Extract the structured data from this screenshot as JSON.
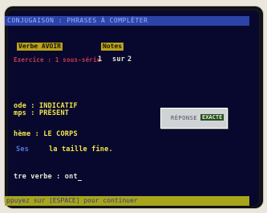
{
  "window": {
    "title": "CONJUGAISON : PHRASES À COMPLÉTER"
  },
  "toolbar": {
    "verb_badge": "Verbe AVOIR",
    "notes_badge": "Notes"
  },
  "progress": {
    "label": "Exercice : 1 sous-série",
    "current": "1",
    "separator": "sur",
    "total": "2"
  },
  "exercise": {
    "mode_label": "ode : INDICATIF",
    "tense_label": "mps : PRÉSENT",
    "theme_label": "hème : LE CORPS",
    "hint_prefix": "Ses",
    "sentence": "la taille fine.",
    "answer_label": "tre verbe : ont"
  },
  "feedback": {
    "label": "RÉPONSE",
    "result": "EXACTE"
  },
  "status": {
    "message": "ppuyez sur [ESPACE] pour continuer"
  },
  "colors": {
    "screen_bg": "#08082e",
    "titlebar": "#2c44a8",
    "highlight": "#b9a21c",
    "statusbar": "#a8a51a"
  }
}
